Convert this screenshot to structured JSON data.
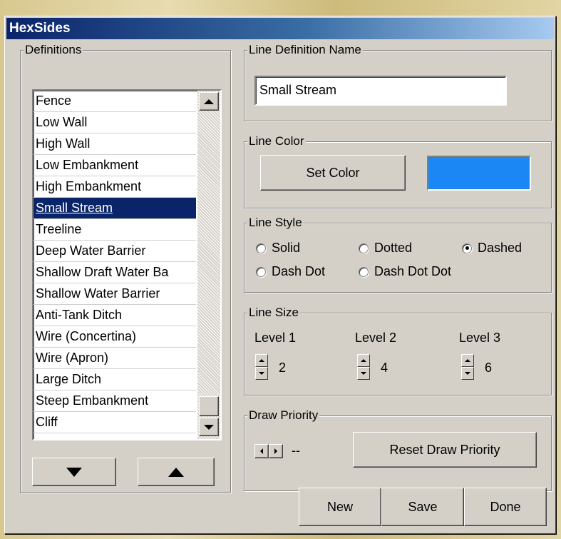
{
  "window": {
    "title": "HexSides"
  },
  "definitions": {
    "group_label": "Definitions",
    "items": [
      {
        "label": "Fence",
        "selected": false
      },
      {
        "label": "Low Wall",
        "selected": false
      },
      {
        "label": "High Wall",
        "selected": false
      },
      {
        "label": "Low Embankment",
        "selected": false
      },
      {
        "label": "High Embankment",
        "selected": false
      },
      {
        "label": "Small Stream",
        "selected": true
      },
      {
        "label": "Treeline",
        "selected": false
      },
      {
        "label": "Deep Water Barrier",
        "selected": false
      },
      {
        "label": "Shallow Draft Water Ba",
        "selected": false
      },
      {
        "label": "Shallow Water Barrier",
        "selected": false
      },
      {
        "label": "Anti-Tank Ditch",
        "selected": false
      },
      {
        "label": "Wire (Concertina)",
        "selected": false
      },
      {
        "label": "Wire (Apron)",
        "selected": false
      },
      {
        "label": "Large Ditch",
        "selected": false
      },
      {
        "label": "Steep Embankment",
        "selected": false
      },
      {
        "label": "Cliff",
        "selected": false
      }
    ],
    "move_down_icon": "triangle-down",
    "move_up_icon": "triangle-up"
  },
  "line_definition_name": {
    "group_label": "Line Definition Name",
    "value": "Small Stream"
  },
  "line_color": {
    "group_label": "Line Color",
    "button_label": "Set Color",
    "swatch_color": "#1a87f5"
  },
  "line_style": {
    "group_label": "Line Style",
    "options": [
      "Solid",
      "Dotted",
      "Dashed",
      "Dash Dot",
      "Dash Dot Dot"
    ],
    "selected": "Dashed"
  },
  "line_size": {
    "group_label": "Line Size",
    "levels": [
      {
        "label": "Level 1",
        "value": "2"
      },
      {
        "label": "Level 2",
        "value": "4"
      },
      {
        "label": "Level 3",
        "value": "6"
      }
    ]
  },
  "draw_priority": {
    "group_label": "Draw Priority",
    "value": "--",
    "reset_label": "Reset Draw Priority"
  },
  "footer": {
    "new_label": "New",
    "save_label": "Save",
    "done_label": "Done"
  },
  "colors": {
    "title_bar": "#0a246a",
    "selection": "#0a246a",
    "face": "#d4d0c8"
  }
}
